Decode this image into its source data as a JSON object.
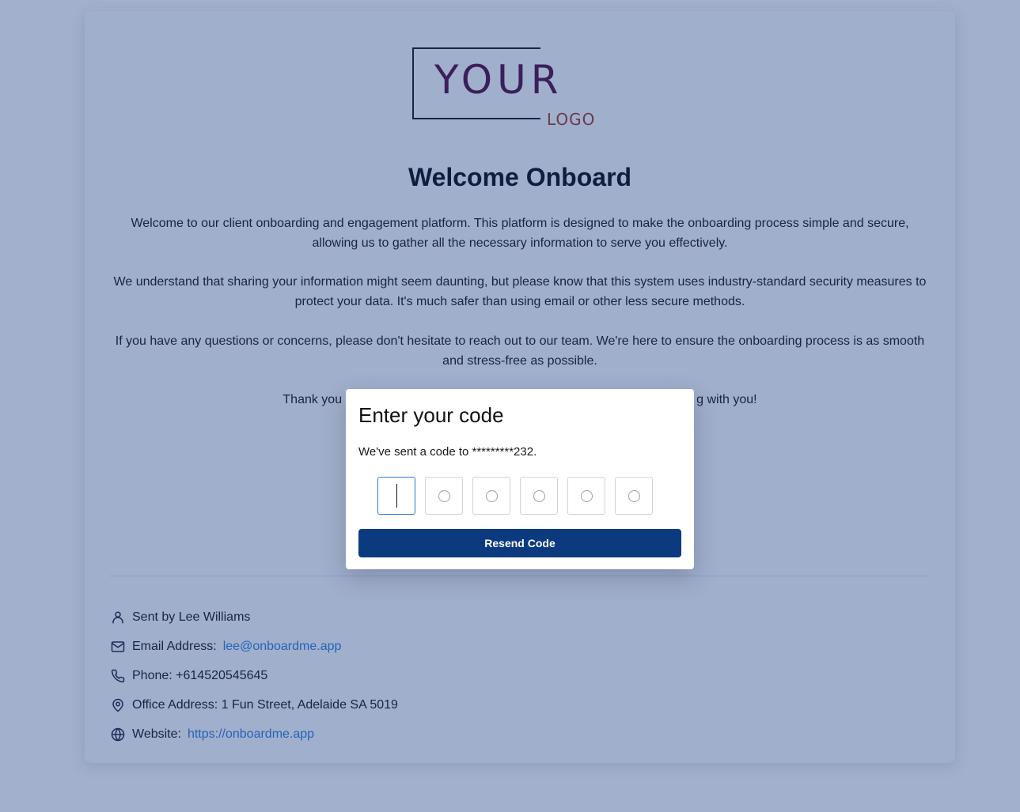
{
  "logo": {
    "word_main": "YOUR",
    "word_sub": "LOGO"
  },
  "welcome": {
    "title": "Welcome Onboard",
    "paragraph1": "Welcome to our client onboarding and engagement platform. This platform is designed to make the onboarding process simple and secure, allowing us to gather all the necessary information to serve you effectively.",
    "paragraph2": "We understand that sharing your information might seem daunting, but please know that this system uses industry-standard security measures to protect your data. It's much safer than using email or other less secure methods.",
    "paragraph3": "If you have any questions or concerns, please don't hesitate to reach out to our team. We're here to ensure the onboarding process is as smooth and stress-free as possible.",
    "paragraph4_visible_left": "Thank you",
    "paragraph4_visible_right": "g with you!"
  },
  "sender_info": {
    "sent_by": "Sent by Lee Williams",
    "email_label": "Email Address:",
    "email_value": "lee@onboardme.app",
    "phone": "Phone: +614520545645",
    "office": "Office Address: 1 Fun Street, Adelaide SA 5019",
    "website_label": "Website:",
    "website_value": "https://onboardme.app"
  },
  "icons": {
    "sent_by": "user-icon",
    "email": "mail-icon",
    "phone": "phone-icon",
    "office": "map-pin-icon",
    "website": "globe-icon"
  },
  "modal": {
    "title": "Enter your code",
    "message": "We've sent a code to *********232.",
    "code_digits": [
      "",
      "",
      "",
      "",
      "",
      ""
    ],
    "resend_label": "Resend Code"
  },
  "colors": {
    "overlay_background": "#a2b0cd",
    "primary_button": "#0b3a7e",
    "link": "#2563b8",
    "active_input_border": "#2f7ed8"
  }
}
